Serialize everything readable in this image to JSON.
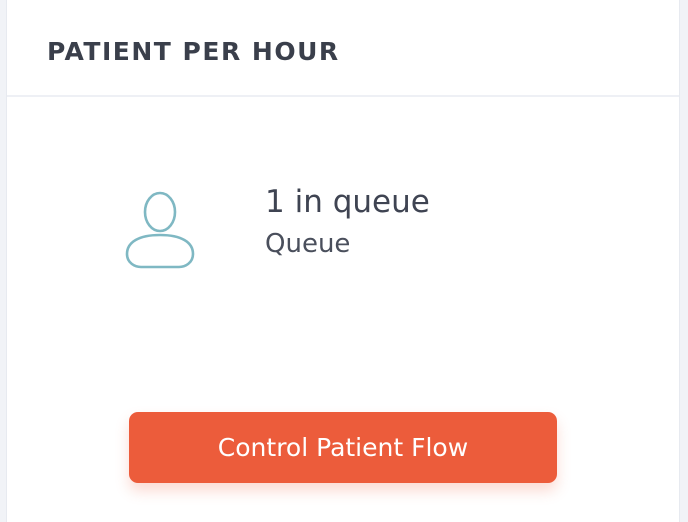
{
  "card": {
    "title": "PATIENT PER HOUR"
  },
  "queue": {
    "icon": "user-icon",
    "value_text": "1 in queue",
    "label": "Queue"
  },
  "action": {
    "button_label": "Control Patient Flow"
  },
  "colors": {
    "accent": "#ec5c3b",
    "icon_stroke": "#7fb8c3",
    "title_text": "#3a3f4b"
  }
}
